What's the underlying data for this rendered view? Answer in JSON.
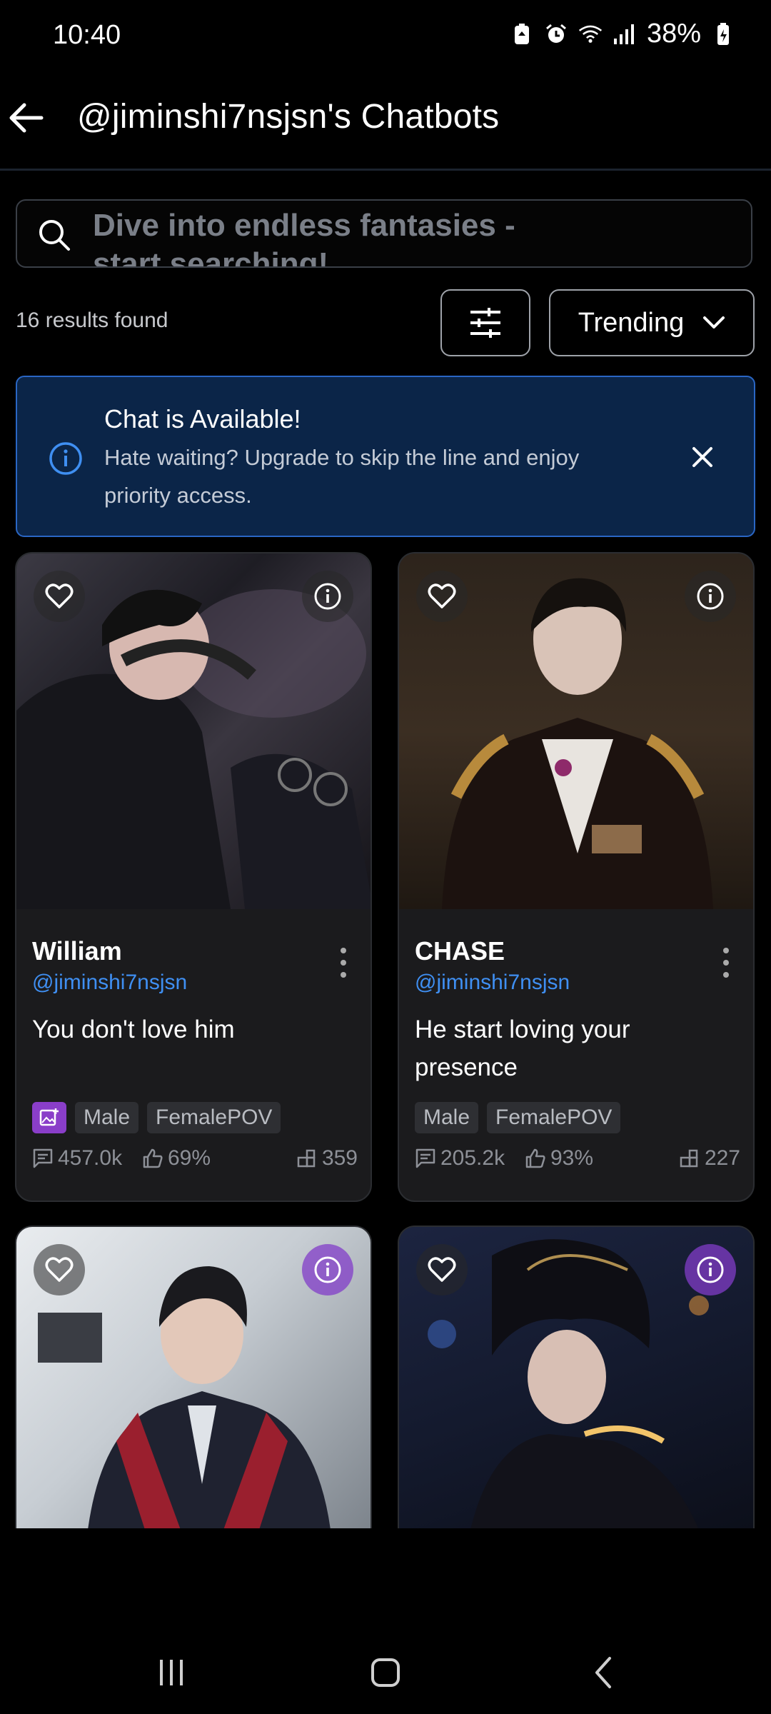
{
  "status": {
    "time": "10:40",
    "battery": "38%"
  },
  "header": {
    "title": "@jiminshi7nsjsn's Chatbots"
  },
  "search": {
    "placeholder": "Dive into endless fantasies - start searching!"
  },
  "results": {
    "count_text": "16 results found"
  },
  "sort": {
    "selected": "Trending"
  },
  "banner": {
    "title": "Chat is Available!",
    "text": "Hate waiting? Upgrade to skip the line and enjoy priority access."
  },
  "cards": [
    {
      "name": "William",
      "user": "@jiminshi7nsjsn",
      "desc": "You don't love him",
      "tags": [
        "Male",
        "FemalePOV"
      ],
      "chats": "457.0k",
      "likes": "69%",
      "count": "359"
    },
    {
      "name": "CHASE",
      "user": "@jiminshi7nsjsn",
      "desc": "He start loving your presence",
      "tags": [
        "Male",
        "FemalePOV"
      ],
      "chats": "205.2k",
      "likes": "93%",
      "count": "227"
    }
  ],
  "colors": {
    "accent": "#3f8ff2",
    "banner_bg": "#0b2548",
    "banner_border": "#2a66c4",
    "tag_purple": "#8a3ec9"
  }
}
